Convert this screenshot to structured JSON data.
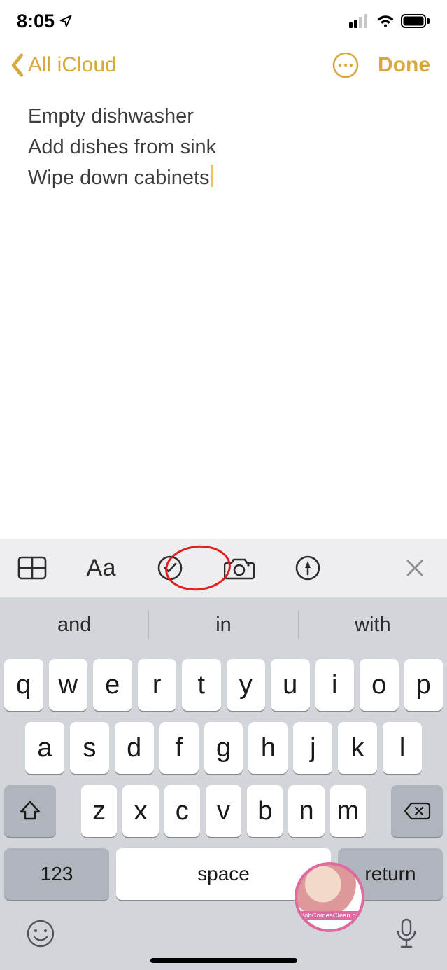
{
  "status": {
    "time": "8:05",
    "location_icon": true
  },
  "nav": {
    "back_label": "All iCloud",
    "done_label": "Done"
  },
  "note": {
    "lines": [
      "Empty dishwasher",
      "Add dishes from sink",
      "Wipe down cabinets"
    ]
  },
  "toolbar": {
    "table_icon": "table-icon",
    "format_label": "Aa",
    "checklist_icon": "checklist-icon",
    "camera_icon": "camera-icon",
    "markup_icon": "markup-icon",
    "close_icon": "close-icon"
  },
  "suggestions": [
    "and",
    "in",
    "with"
  ],
  "keyboard": {
    "row1": [
      "q",
      "w",
      "e",
      "r",
      "t",
      "y",
      "u",
      "i",
      "o",
      "p"
    ],
    "row2": [
      "a",
      "s",
      "d",
      "f",
      "g",
      "h",
      "j",
      "k",
      "l"
    ],
    "row3": [
      "z",
      "x",
      "c",
      "v",
      "b",
      "n",
      "m"
    ],
    "numbers_label": "123",
    "space_label": "space",
    "return_label": "return"
  },
  "watermark": {
    "text": "ASlobComesClean.com"
  }
}
